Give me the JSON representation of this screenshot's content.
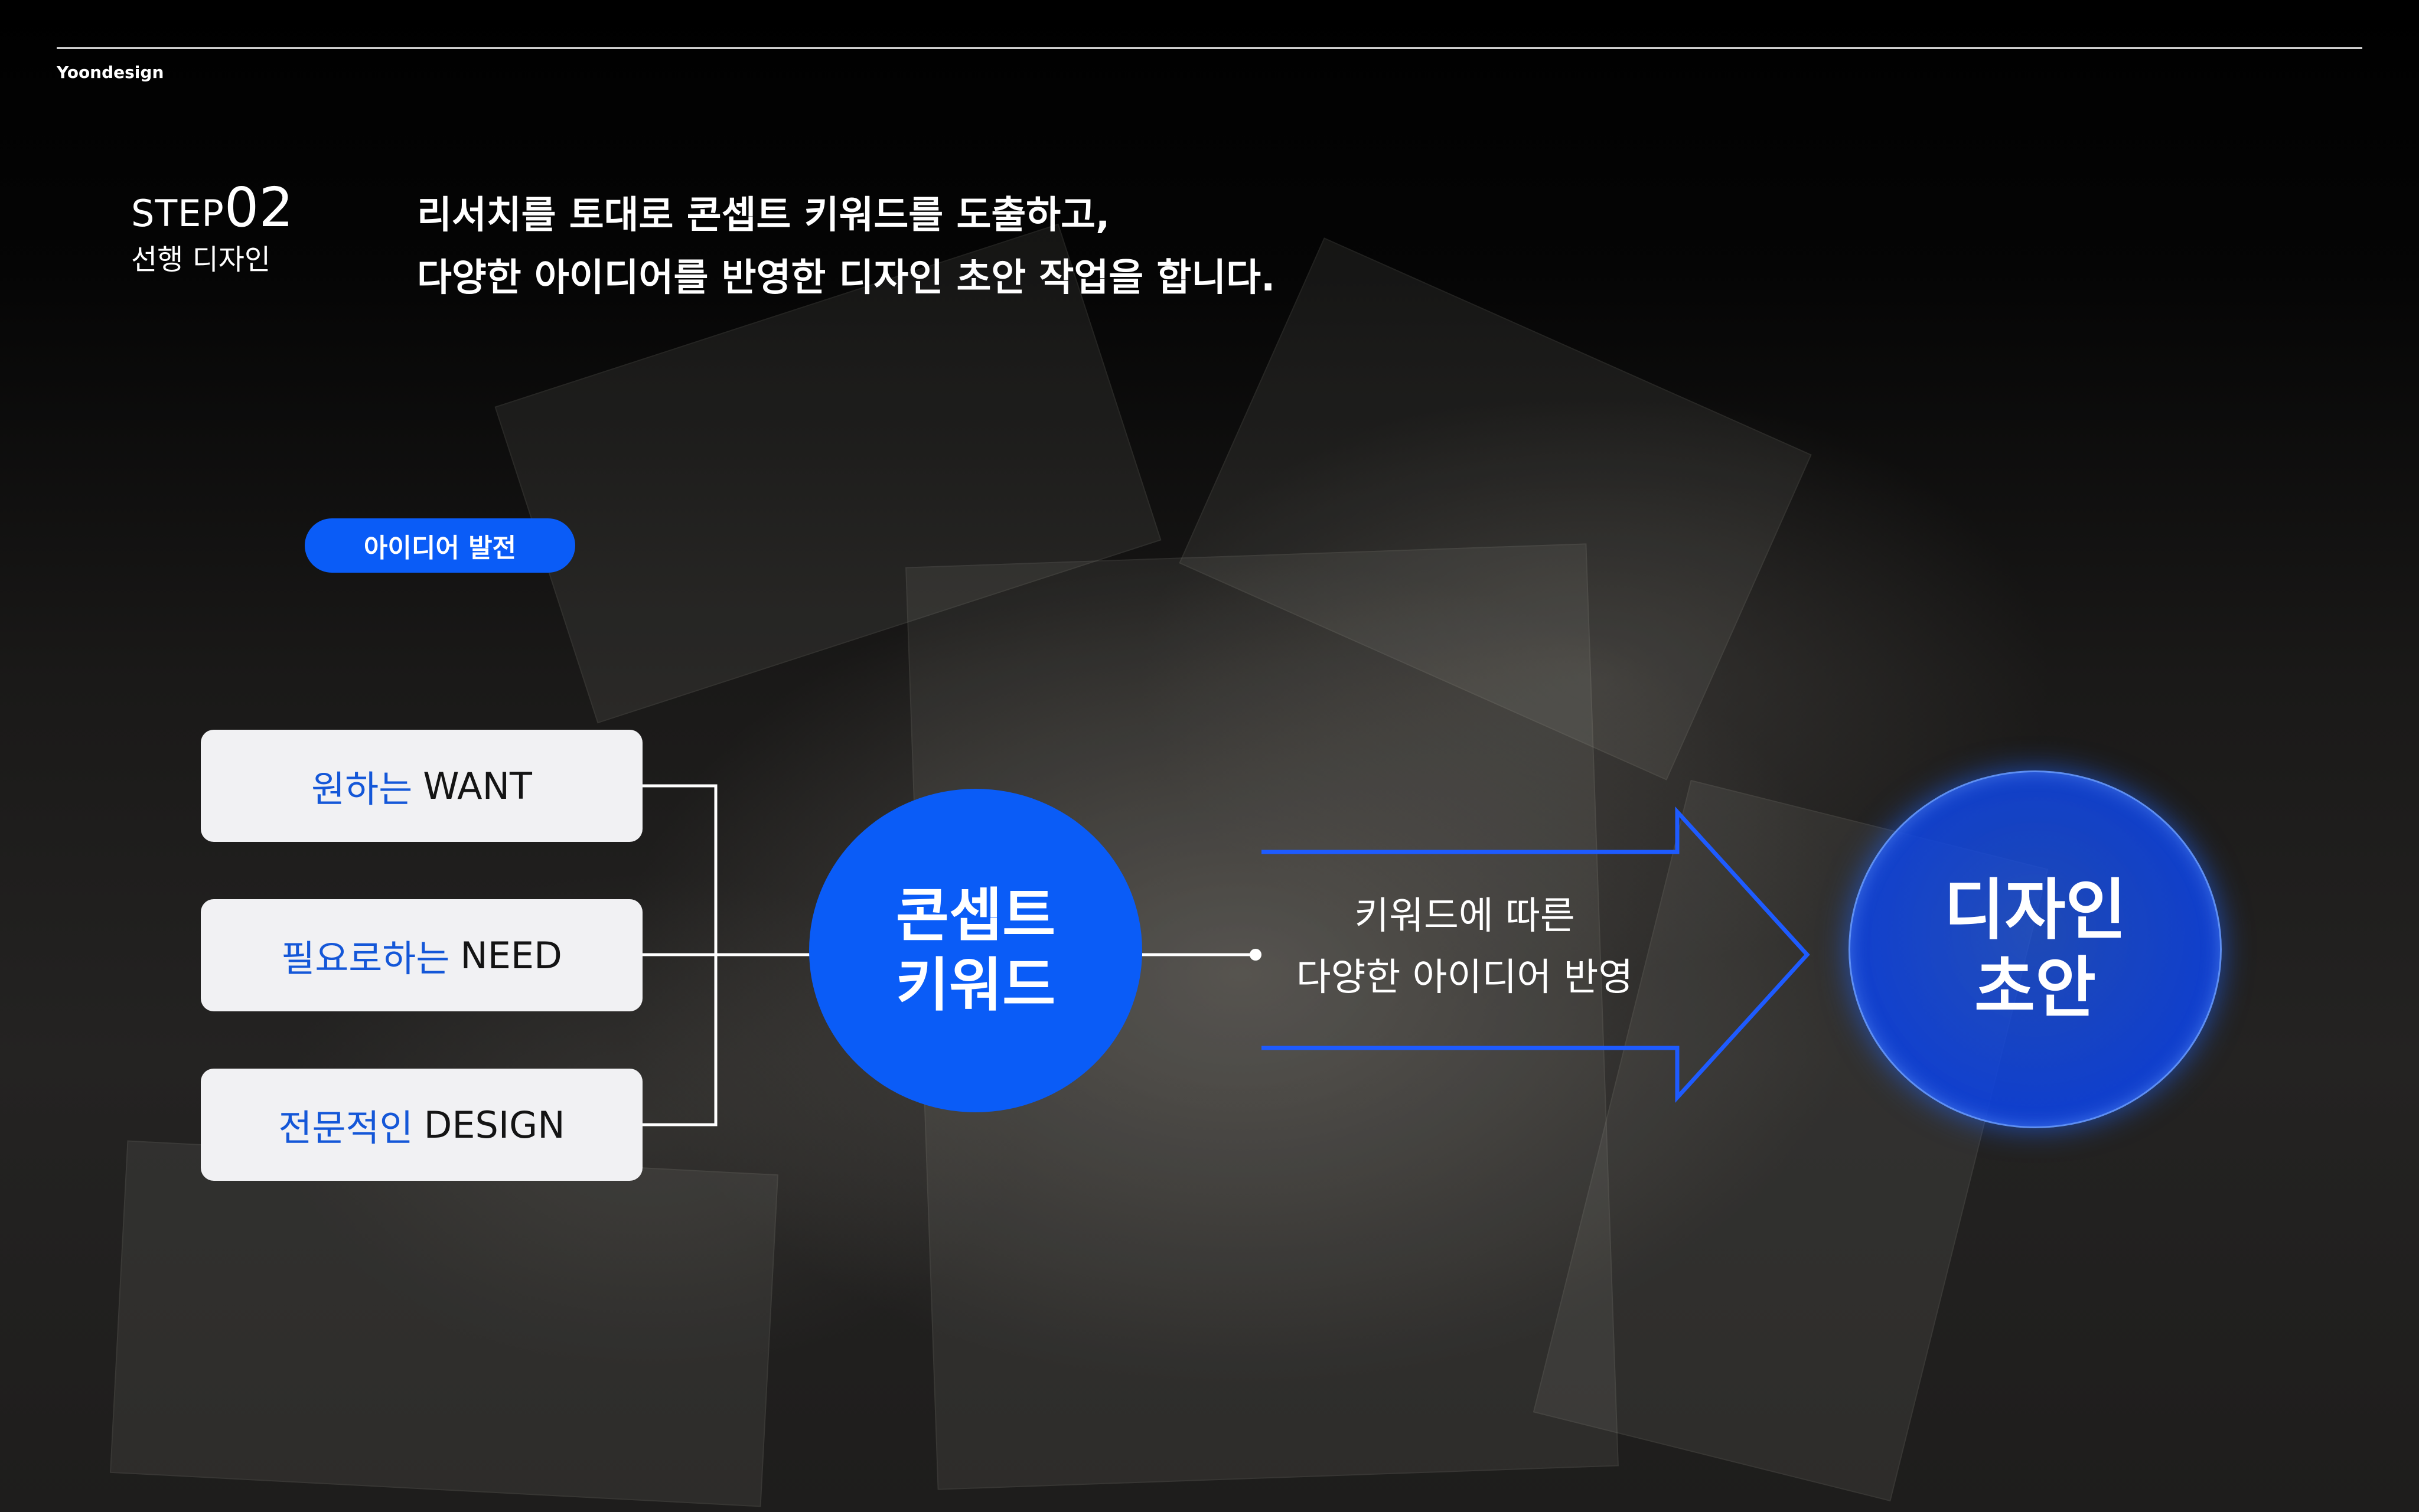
{
  "header": {
    "brand": "Yoondesign"
  },
  "step": {
    "word": "STEP",
    "number": "02",
    "subtitle": "선행 디자인"
  },
  "headline": {
    "line1": "리서치를 토대로 콘셉트 키워드를 도출하고,",
    "line2": "다양한 아이디어를 반영한 디자인 초안 작업을 합니다."
  },
  "tag": {
    "label": "아이디어 발전"
  },
  "inputs": [
    {
      "ko": "원하는",
      "en": "WANT"
    },
    {
      "ko": "필요로하는",
      "en": "NEED"
    },
    {
      "ko": "전문적인",
      "en": "DESIGN"
    }
  ],
  "concept": {
    "line1": "콘셉트",
    "line2": "키워드"
  },
  "process": {
    "line1": "키워드에 따른",
    "line2": "다양한 아이디어 반영"
  },
  "output": {
    "line1": "디자인",
    "line2": "초안"
  },
  "colors": {
    "accent": "#0A5CF7",
    "arrow": "#1E5BFF",
    "card": "#F1F1F3",
    "text": "#FFFFFF"
  }
}
